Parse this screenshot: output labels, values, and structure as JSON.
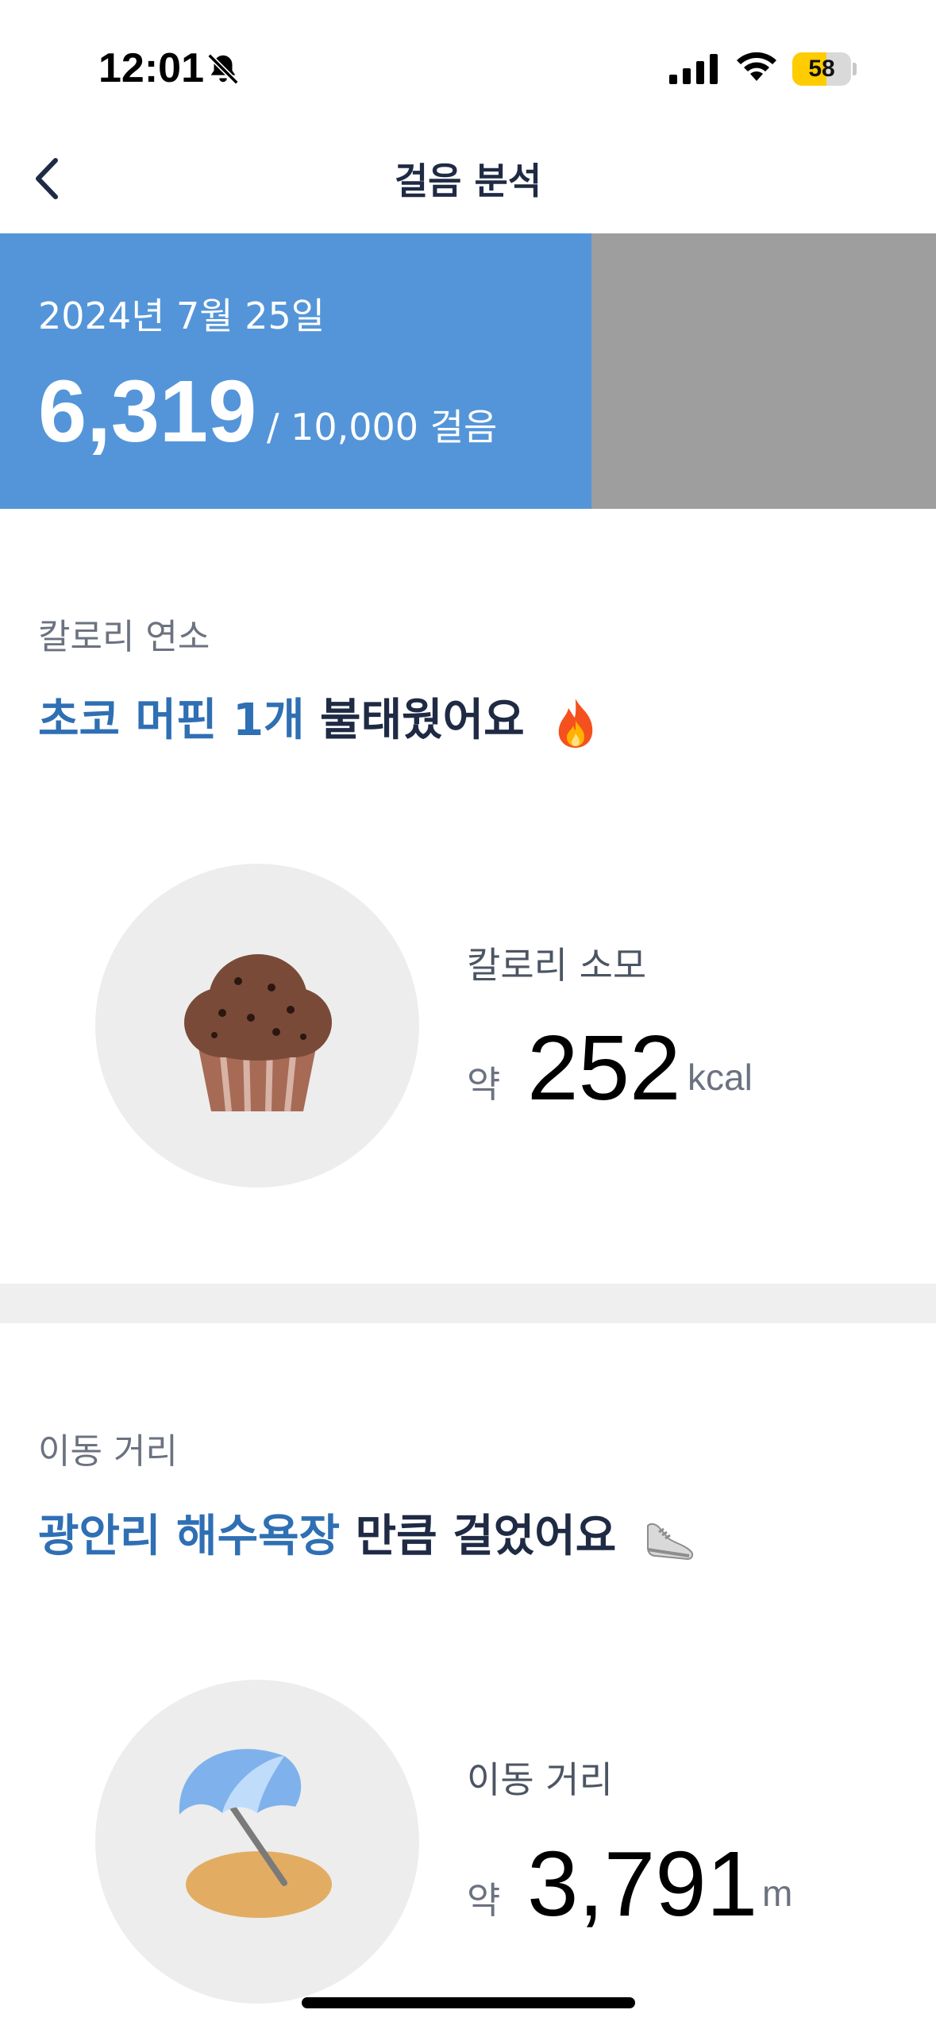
{
  "status_bar": {
    "time": "12:01",
    "battery_level": "58",
    "battery_fraction": 0.58,
    "icons": [
      "bell-muted-icon",
      "cellular-signal-icon",
      "wifi-icon",
      "battery-icon"
    ]
  },
  "nav": {
    "back_icon": "chevron-left-icon",
    "title": "걸음 분석"
  },
  "banner": {
    "date": "2024년 7월 25일",
    "steps": "6,319",
    "goal_text": "/ 10,000 걸음",
    "progress_fraction": 0.6319,
    "fill_color": "#5495d9",
    "remaining_color": "#9e9e9e"
  },
  "calorie_section": {
    "label": "칼로리 연소",
    "headline_highlight": "초코 머핀 1개",
    "headline_rest": " 불태웠어요",
    "headline_icon": "fire-icon",
    "illustration_icon": "chocolate-muffin-icon",
    "stat_label": "칼로리 소모",
    "stat_prefix": "약",
    "stat_value": "252",
    "stat_unit": "kcal"
  },
  "distance_section": {
    "label": "이동 거리",
    "headline_highlight": "광안리 해수욕장",
    "headline_rest": " 만큼 걸었어요",
    "headline_icon": "sneaker-icon",
    "illustration_icon": "beach-umbrella-icon",
    "stat_label": "이동 거리",
    "stat_prefix": "약",
    "stat_value": "3,791",
    "stat_unit": "m"
  },
  "colors": {
    "accent_blue": "#2f6fb4",
    "headline_dark": "#1f2a44"
  }
}
